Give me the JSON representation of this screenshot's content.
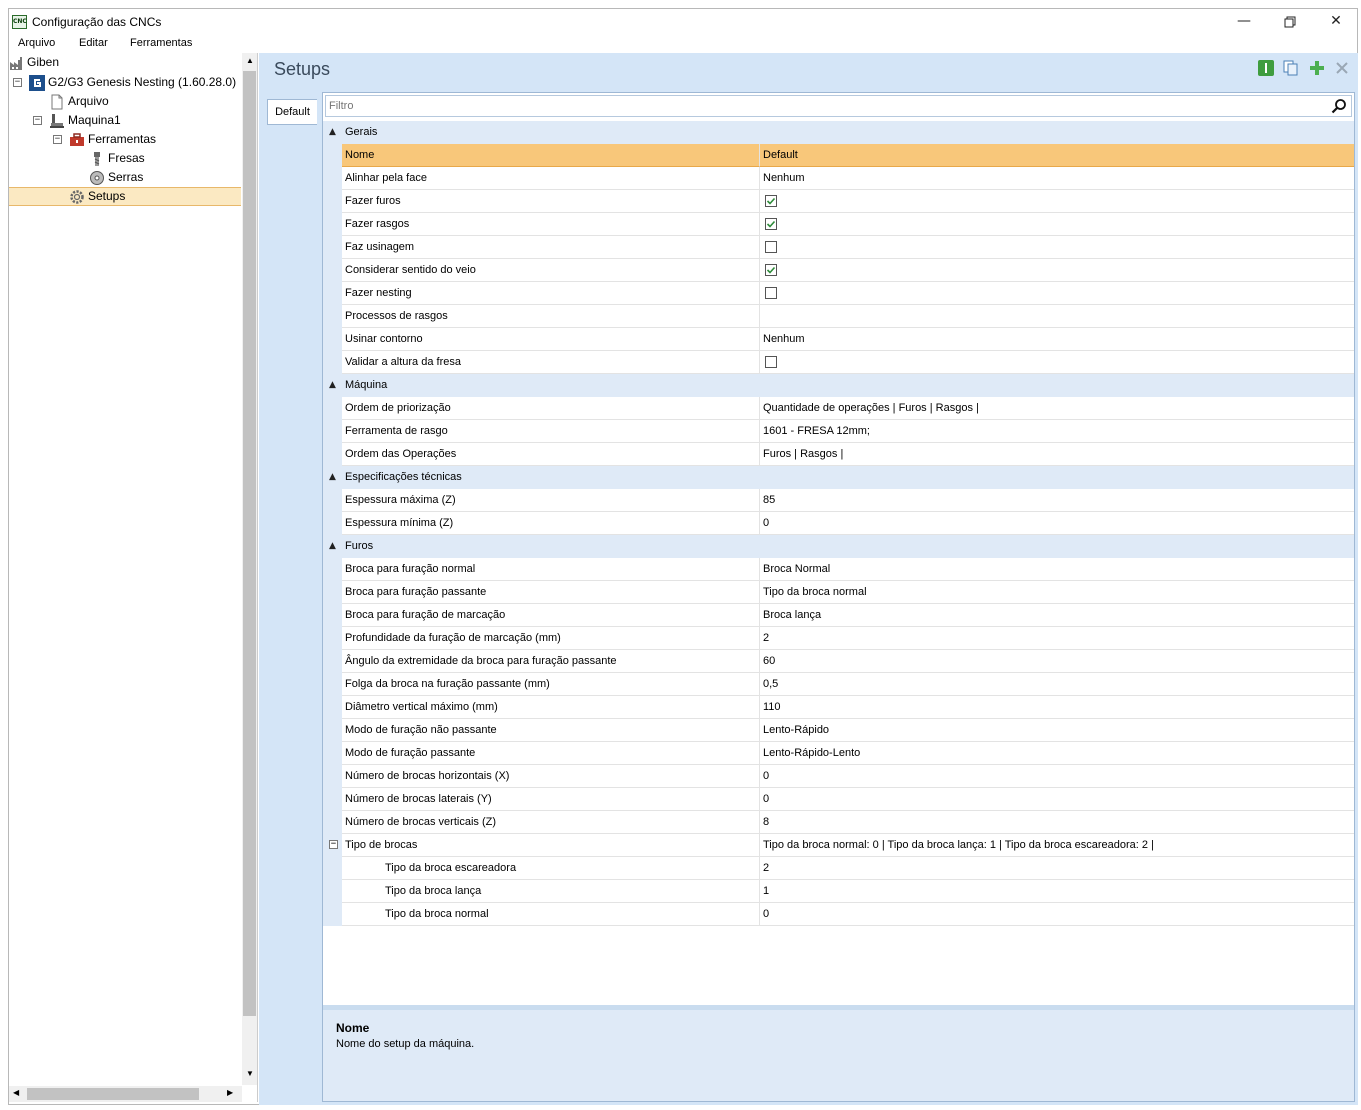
{
  "window": {
    "title": "Configuração das CNCs",
    "icon": "cnc-app-icon",
    "icon_text": "CNC"
  },
  "menu": [
    "Arquivo",
    "Editar",
    "Ferramentas"
  ],
  "tree": {
    "root": "Giben",
    "app": "G2/G3 Genesis Nesting (1.60.28.0)",
    "arquivo": "Arquivo",
    "maquina": "Maquina1",
    "ferramentas": "Ferramentas",
    "fresas": "Fresas",
    "serras": "Serras",
    "setups": "Setups"
  },
  "panel": {
    "title": "Setups",
    "tab": "Default",
    "filter_placeholder": "Filtro"
  },
  "grid_header": {
    "name": "Nome",
    "value": "Default"
  },
  "categories": {
    "gerais": "Gerais",
    "maquina": "Máquina",
    "especificacoes": "Especificações técnicas",
    "furos": "Furos"
  },
  "props": {
    "gerais": [
      {
        "name": "Alinhar pela face",
        "value": "Nenhum"
      },
      {
        "name": "Fazer furos",
        "checked": true
      },
      {
        "name": "Fazer rasgos",
        "checked": true
      },
      {
        "name": "Faz usinagem",
        "checked": false
      },
      {
        "name": "Considerar sentido do veio",
        "checked": true
      },
      {
        "name": "Fazer nesting",
        "checked": false
      },
      {
        "name": "Processos de rasgos",
        "value": ""
      },
      {
        "name": "Usinar contorno",
        "value": "Nenhum"
      },
      {
        "name": "Validar a altura da fresa",
        "checked": false
      }
    ],
    "maquina": [
      {
        "name": "Ordem de priorização",
        "value": "Quantidade de operações | Furos | Rasgos |"
      },
      {
        "name": "Ferramenta de rasgo",
        "value": "1601 - FRESA 12mm;"
      },
      {
        "name": "Ordem das Operações",
        "value": "Furos | Rasgos |"
      }
    ],
    "especificacoes": [
      {
        "name": "Espessura máxima (Z)",
        "value": "85"
      },
      {
        "name": "Espessura mínima (Z)",
        "value": "0"
      }
    ],
    "furos": [
      {
        "name": "Broca para furação normal",
        "value": "Broca Normal"
      },
      {
        "name": "Broca para furação passante",
        "value": "Tipo da broca normal"
      },
      {
        "name": "Broca para furação de marcação",
        "value": "Broca lança"
      },
      {
        "name": "Profundidade da furação de marcação (mm)",
        "value": "2"
      },
      {
        "name": "Ângulo da extremidade da broca para furação passante",
        "value": "60"
      },
      {
        "name": "Folga da broca na furação passante (mm)",
        "value": "0,5"
      },
      {
        "name": "Diâmetro vertical máximo (mm)",
        "value": "110"
      },
      {
        "name": "Modo de furação não passante",
        "value": "Lento-Rápido"
      },
      {
        "name": "Modo de furação passante",
        "value": "Lento-Rápido-Lento"
      },
      {
        "name": "Número de brocas horizontais (X)",
        "value": "0"
      },
      {
        "name": "Número de brocas laterais (Y)",
        "value": "0"
      },
      {
        "name": "Número de brocas verticais (Z)",
        "value": "8"
      },
      {
        "name": "Tipo de brocas",
        "value": "Tipo da broca normal: 0  |  Tipo da broca lança: 1  |  Tipo da broca escareadora: 2  |"
      }
    ],
    "tipo_brocas": [
      {
        "name": "Tipo da broca escareadora",
        "value": "2"
      },
      {
        "name": "Tipo da broca lança",
        "value": "1"
      },
      {
        "name": "Tipo da broca normal",
        "value": "0"
      }
    ]
  },
  "description": {
    "title": "Nome",
    "text": "Nome do setup da máquina."
  },
  "colors": {
    "header_row": "#f8c77a",
    "category_row": "#dfeaf7",
    "panel_bg": "#d4e5f7",
    "selection": "#fbe9c2"
  }
}
